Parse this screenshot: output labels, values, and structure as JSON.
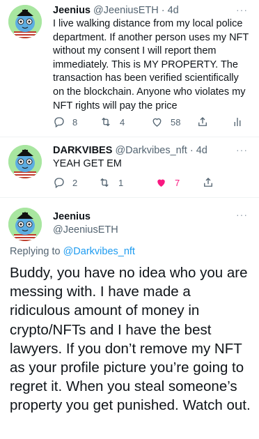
{
  "tweet1": {
    "name": "Jeenius",
    "handle": "@JeeniusETH",
    "time": "· 4d",
    "more": "···",
    "text": "I live walking distance from my local police department. If another person uses my NFT without my consent I will report them immediately. This is MY PROPERTY. The transaction has been verified scientifically on the blockchain. Anyone who violates my  NFT rights will pay the price",
    "replies": "8",
    "retweets": "4",
    "likes": "58",
    "liked": false
  },
  "tweet2": {
    "name": "DARKVIBES",
    "handle": "@Darkvibes_nft",
    "time": "· 4d",
    "more": "···",
    "text": "YEAH GET EM",
    "replies": "2",
    "retweets": "1",
    "likes": "7",
    "liked": true
  },
  "tweet3": {
    "name": "Jeenius",
    "handle": "@JeeniusETH",
    "more": "···",
    "replying_prefix": "Replying to",
    "replying_to": "@Darkvibes_nft",
    "text": "Buddy, you have no idea who you are messing with. I have made a ridiculous amount of money in crypto/NFTs and I have the best lawyers. If you don’t remove my NFT as your profile picture you’re going to regret it. When you steal someone’s property you get punished. Watch out."
  },
  "colors": {
    "text": "#0f1419",
    "secondary": "#536471",
    "link": "#1d9bf0",
    "like": "#f91880",
    "avatar_bg": "#a8e6a0"
  },
  "icons": [
    "reply-icon",
    "retweet-icon",
    "like-icon",
    "share-icon",
    "analytics-icon",
    "more-icon"
  ]
}
